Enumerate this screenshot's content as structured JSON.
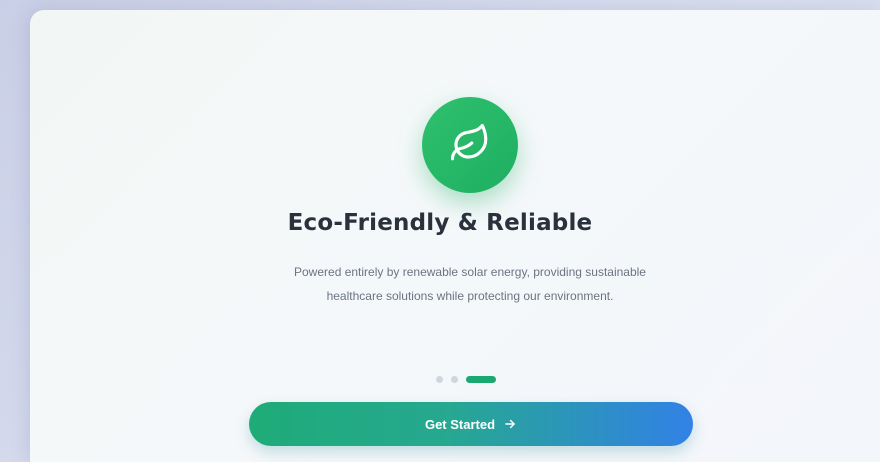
{
  "onboarding": {
    "icon": "leaf-icon",
    "title": "Eco-Friendly & Reliable",
    "description": "Powered entirely by renewable solar energy, providing sustainable healthcare solutions while protecting our environment.",
    "pagination": {
      "total": 3,
      "current": 3
    },
    "cta_label": "Get Started",
    "cta_icon": "arrow-right-icon"
  },
  "colors": {
    "accent_green": "#1fae62",
    "gradient_start": "#1fab77",
    "gradient_end": "#3281e6",
    "title": "#2b313c",
    "text_muted": "#6c7482"
  }
}
